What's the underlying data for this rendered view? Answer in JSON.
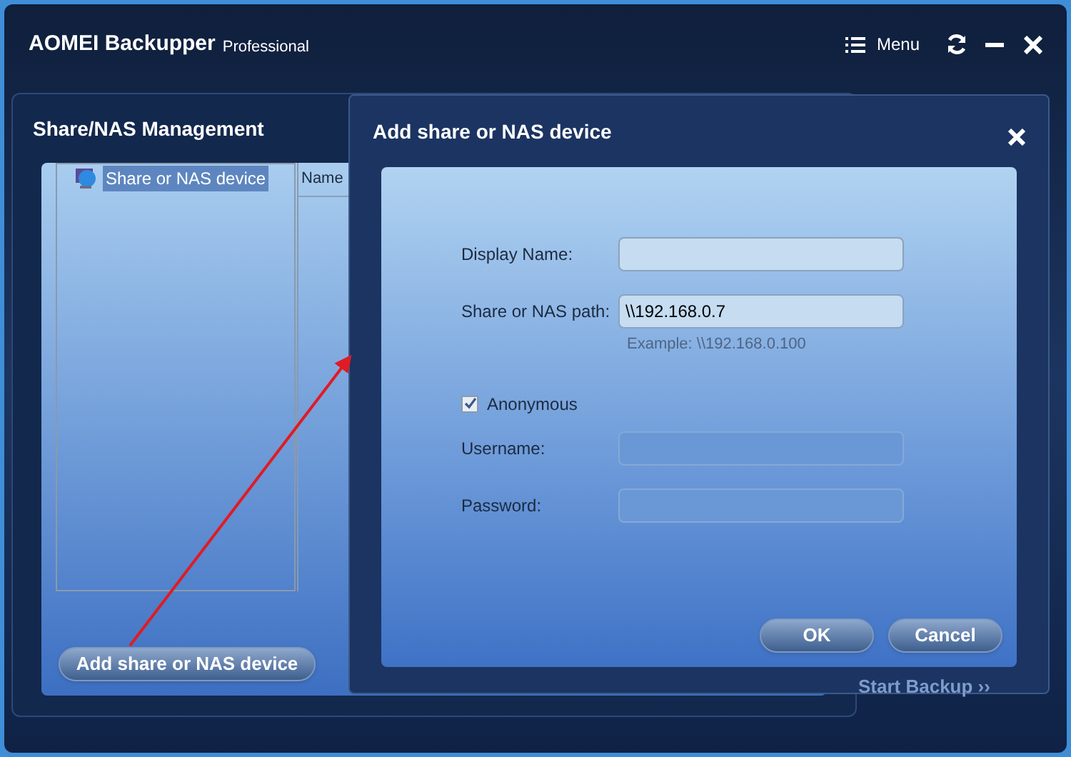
{
  "app": {
    "title": "AOMEI Backupper",
    "edition": "Professional",
    "menu_label": "Menu"
  },
  "management_dialog": {
    "title": "Share/NAS Management",
    "tree": [
      {
        "label": "Share or NAS device",
        "selected": true
      }
    ],
    "columns": [
      "Name"
    ],
    "add_button": "Add share or NAS device"
  },
  "background_button": "Start Backup ››",
  "add_dialog": {
    "title": "Add share or NAS device",
    "items": [
      {
        "kind": "field",
        "label": "Display Name:",
        "disabled": false
      },
      {
        "kind": "field",
        "label": "Share or NAS path:",
        "value": "\\\\192.168.0.7",
        "hint": "Example: \\\\192.168.0.100",
        "disabled": false
      },
      {
        "kind": "checkbox",
        "label": "Anonymous",
        "checked": true
      },
      {
        "kind": "field",
        "label": "Username:",
        "disabled": true
      },
      {
        "kind": "field",
        "label": "Password:",
        "disabled": true
      }
    ],
    "buttons": [
      "OK",
      "Cancel"
    ]
  }
}
